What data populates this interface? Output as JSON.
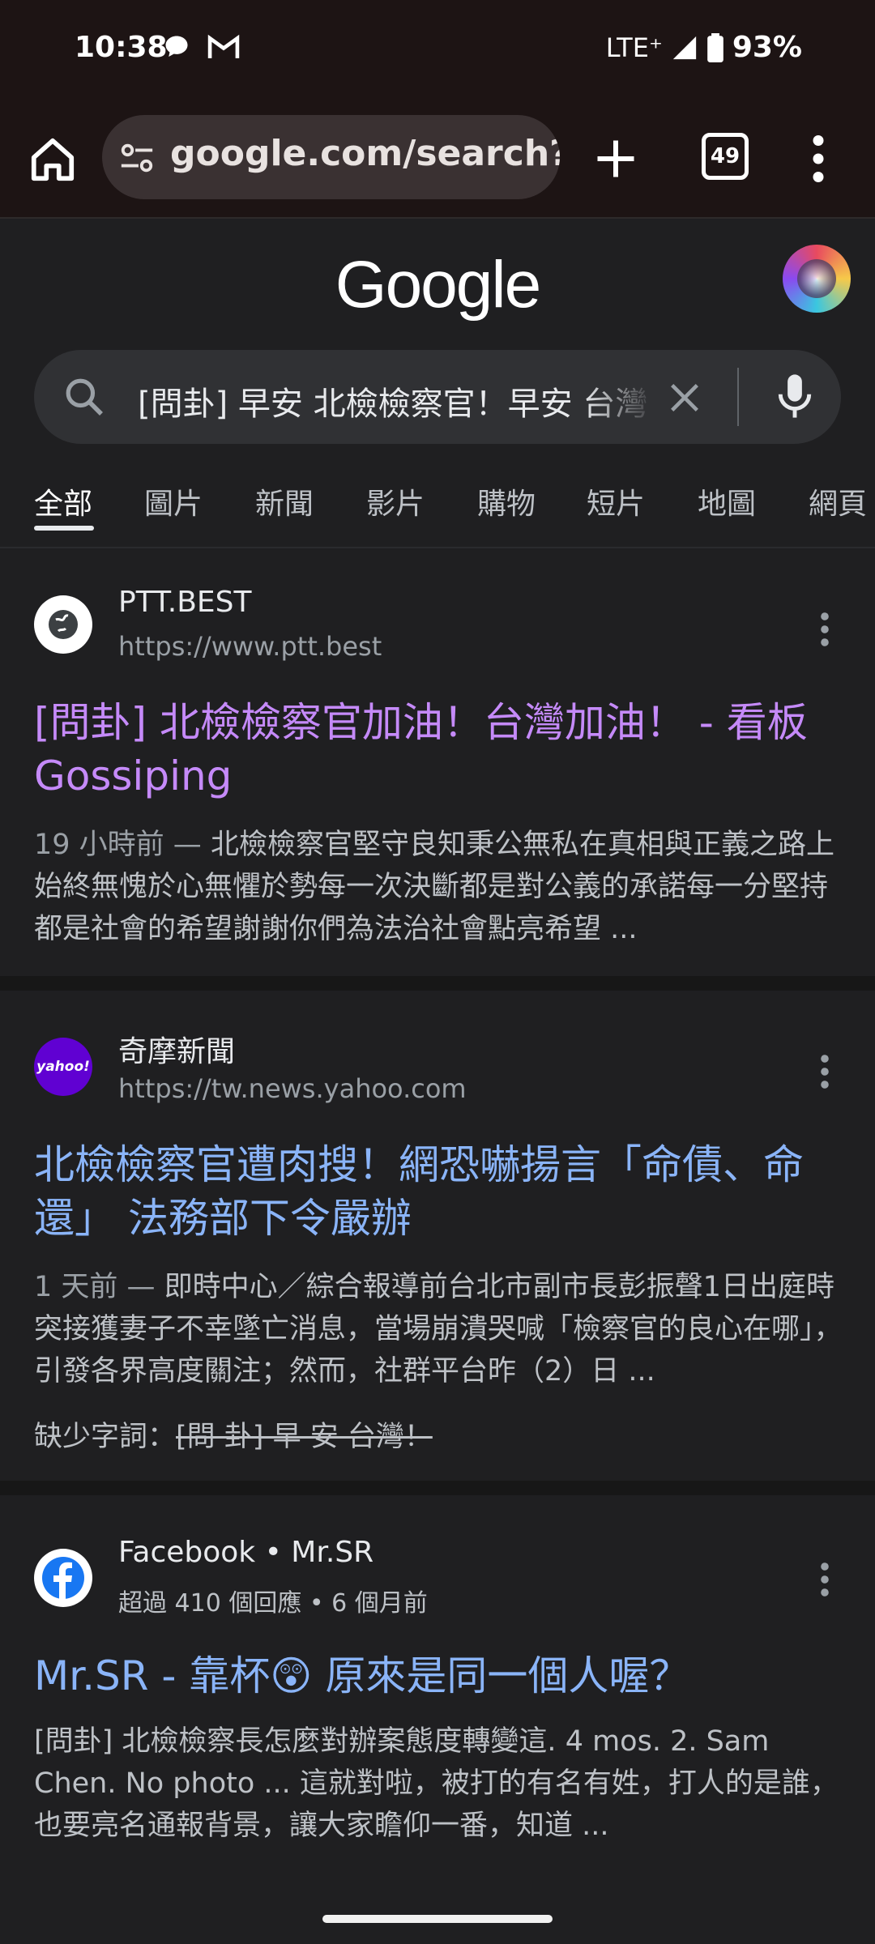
{
  "status_bar": {
    "time": "10:38",
    "network": "LTE⁺",
    "battery": "93%",
    "icons": [
      "chat-bubble-icon",
      "gmail-icon",
      "signal-icon",
      "battery-icon"
    ]
  },
  "toolbar": {
    "url": "google.com/search?q=",
    "tab_count": "49"
  },
  "google": {
    "logo": "Google",
    "search_query": "[問卦] 早安 北檢檢察官！早安 台灣"
  },
  "tabs": [
    {
      "label": "全部",
      "active": true
    },
    {
      "label": "圖片"
    },
    {
      "label": "新聞"
    },
    {
      "label": "影片"
    },
    {
      "label": "購物"
    },
    {
      "label": "短片"
    },
    {
      "label": "地圖"
    },
    {
      "label": "網頁"
    }
  ],
  "results": [
    {
      "site": "PTT.BEST",
      "url": "https://www.ptt.best",
      "title": "[問卦] 北檢檢察官加油！台灣加油！ - 看板 Gossiping",
      "date": "19 小時前",
      "dash": " — ",
      "snippet": "北檢檢察官堅守良知秉公無私在真相與正義之路上始終無愧於心無懼於勢每一次決斷都是對公義的承諾每一分堅持都是社會的希望謝謝你們為法治社會點亮希望 ..."
    },
    {
      "site": "奇摩新聞",
      "url": "https://tw.news.yahoo.com",
      "favicon_text": "yahoo!",
      "title": "北檢檢察官遭肉搜！網恐嚇揚言「命債、命還」 法務部下令嚴辦",
      "date": "1 天前",
      "dash": " — ",
      "snippet": "即時中心／綜合報導前台北市副市長彭振聲1日出庭時突接獲妻子不幸墜亡消息，當場崩潰哭喊「檢察官的良心在哪」，引發各界高度關注；然而，社群平台昨（2）日 ...",
      "missing_label": "缺少字詞：",
      "missing_words": "[問 卦] 早 安 台灣！"
    },
    {
      "site": "Facebook",
      "site_extra": "Mr.SR",
      "meta": "超過 410 個回應 • 6 個月前",
      "title": "Mr.SR - 靠杯😲 原來是同一個人喔？",
      "snippet": "[問卦] 北檢檢察長怎麼對辦案態度轉變這. 4 mos. 2. Sam Chen. No photo ... 這就對啦，被打的有名有姓，打人的是誰， 也要亮名通報背景，讓大家瞻仰一番，知道 ..."
    }
  ],
  "colors": {
    "background": "#1f1f21",
    "visited_link": "#c58af9",
    "link": "#8ab4f8",
    "snippet": "#bdc1c6"
  }
}
